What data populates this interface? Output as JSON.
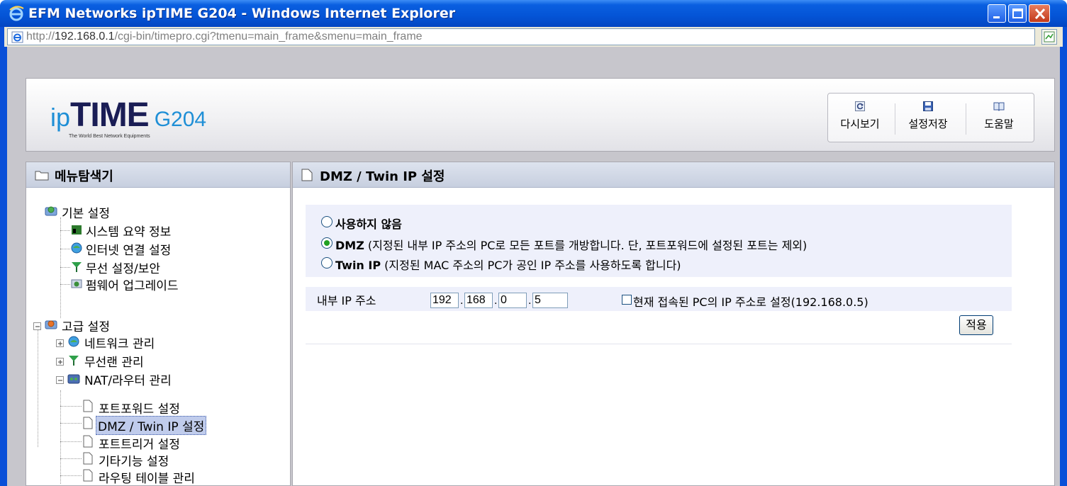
{
  "window": {
    "title": "EFM Networks ipTIME G204 - Windows Internet Explorer",
    "url_prefix": "http://",
    "url_host": "192.168.0.1",
    "url_rest": "/cgi-bin/timepro.cgi?tmenu=main_frame&smenu=main_frame"
  },
  "header": {
    "logo_ip": "ip",
    "logo_time": "TIME",
    "logo_model": "G204",
    "logo_tagline": "The World Best Network Equipments",
    "tools": [
      {
        "label": "다시보기",
        "icon": "refresh-icon"
      },
      {
        "label": "설정저장",
        "icon": "save-icon"
      },
      {
        "label": "도움말",
        "icon": "help-book-icon"
      }
    ]
  },
  "menu": {
    "title": "메뉴탐색기",
    "basic": {
      "label": "기본 설정",
      "items": [
        "시스템 요약 정보",
        "인터넷 연결 설정",
        "무선 설정/보안",
        "펌웨어 업그레이드"
      ]
    },
    "advanced": {
      "label": "고급 설정",
      "groups": [
        "네트워크 관리",
        "무선랜 관리",
        "NAT/라우터 관리"
      ],
      "nat_items": [
        "포트포워드 설정",
        "DMZ / Twin IP 설정",
        "포트트리거 설정",
        "기타기능 설정",
        "라우팅 테이블 관리"
      ],
      "selected": "DMZ / Twin IP 설정"
    }
  },
  "content": {
    "title": "DMZ / Twin IP 설정",
    "options": [
      {
        "bold": "사용하지 않음",
        "desc": "",
        "checked": false
      },
      {
        "bold": "DMZ",
        "desc": " (지정된 내부 IP 주소의 PC로 모든 포트를 개방합니다. 단, 포트포워드에 설정된 포트는 제외)",
        "checked": true
      },
      {
        "bold": "Twin IP",
        "desc": " (지정된 MAC 주소의 PC가 공인 IP 주소를 사용하도록 합니다)",
        "checked": false
      }
    ],
    "ip_label": "내부 IP 주소",
    "ip_octets": [
      "192",
      "168",
      "0",
      "5"
    ],
    "current_pc_label": "현재 접속된 PC의 IP 주소로 설정(192.168.0.5)",
    "apply_label": "적용"
  }
}
